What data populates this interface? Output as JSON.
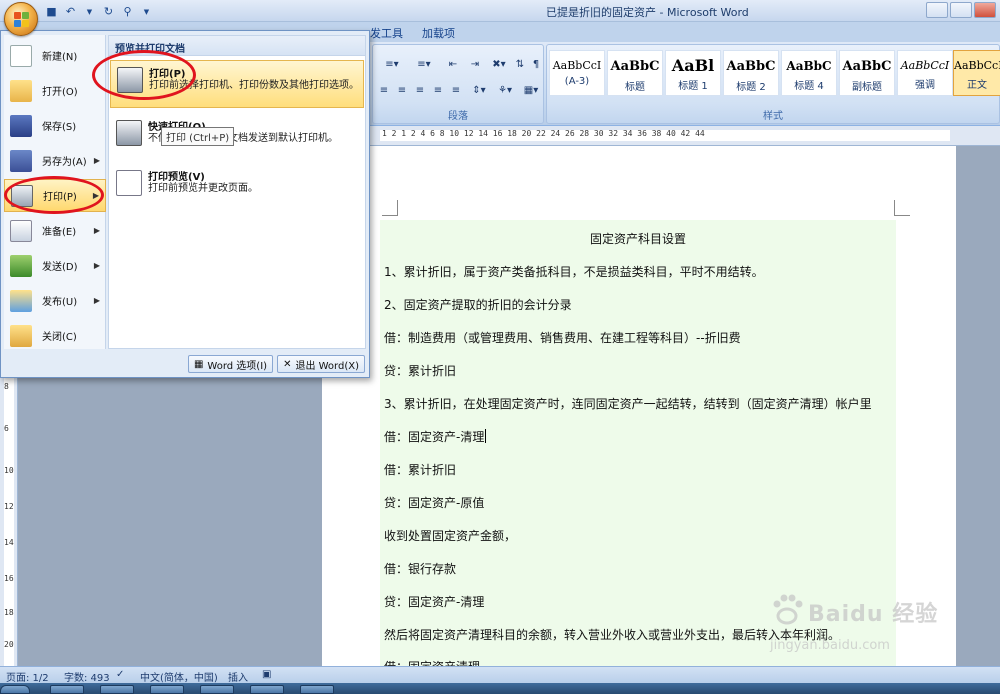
{
  "window": {
    "title": "已提是折旧的固定资产 - Microsoft Word"
  },
  "ribbon": {
    "tabs": [
      "发工具",
      "加载项"
    ],
    "paragraph_label": "段落",
    "styles_label": "样式",
    "styles": [
      {
        "sample": "AaBbCcI",
        "name": "(A-3)"
      },
      {
        "sample": "AaBbC",
        "name": "标题"
      },
      {
        "sample": "AaBl",
        "name": "标题 1"
      },
      {
        "sample": "AaBbC",
        "name": "标题 2"
      },
      {
        "sample": "AaBbC",
        "name": "标题 4"
      },
      {
        "sample": "AaBbC",
        "name": "副标题"
      },
      {
        "sample": "AaBbCcI",
        "name": "强调"
      },
      {
        "sample": "AaBbCcI",
        "name": "正文",
        "active": true
      }
    ]
  },
  "ruler": {
    "top_text": "1  2  1  2  4  6  8  10  12  14  16  18  20  22  24  26  28  30  32  34  36  38  40  42  44",
    "left_numbers": [
      "8",
      "6",
      "10",
      "12",
      "14",
      "16",
      "18",
      "20",
      "22"
    ]
  },
  "document": {
    "lines": [
      "固定资产科目设置",
      "1、累计折旧，属于资产类备抵科目，不是损益类科目，平时不用结转。",
      "2、固定资产提取的折旧的会计分录",
      "借：制造费用（或管理费用、销售费用、在建工程等科目）--折旧费",
      "贷：累计折旧",
      "3、累计折旧，在处理固定资产时，连同固定资产一起结转，结转到（固定资产清理）帐户里",
      "借：固定资产-清理",
      "借：累计折旧",
      "贷：固定资产-原值",
      "收到处置固定资产金额，",
      "借：银行存款",
      "贷：固定资产-清理",
      "然后将固定资产清理科目的余额，转入营业外收入或营业外支出，最后转入本年利润。",
      "借：固定资产清理"
    ]
  },
  "office_menu": {
    "items": [
      {
        "label": "新建(N)",
        "icon": "new-document-icon",
        "has_arrow": false
      },
      {
        "label": "打开(O)",
        "icon": "open-folder-icon",
        "has_arrow": false
      },
      {
        "label": "保存(S)",
        "icon": "save-icon",
        "has_arrow": false
      },
      {
        "label": "另存为(A)",
        "icon": "save-as-icon",
        "has_arrow": true
      },
      {
        "label": "打印(P)",
        "icon": "print-icon",
        "has_arrow": true,
        "selected": true
      },
      {
        "label": "准备(E)",
        "icon": "prepare-icon",
        "has_arrow": true
      },
      {
        "label": "发送(D)",
        "icon": "send-icon",
        "has_arrow": true
      },
      {
        "label": "发布(U)",
        "icon": "publish-icon",
        "has_arrow": true
      },
      {
        "label": "关闭(C)",
        "icon": "close-folder-icon",
        "has_arrow": false
      }
    ],
    "submenu_header": "预览并打印文档",
    "submenu": [
      {
        "title": "打印(P)",
        "desc": "打印前选择打印机、打印份数及其他打印选项。",
        "icon": "printer-icon",
        "highlighted": true
      },
      {
        "title": "快速打印(Q)",
        "desc": "不做更改，直接将文档发送到默认打印机。",
        "icon": "quick-print-icon"
      },
      {
        "title": "打印预览(V)",
        "desc": "打印前预览并更改页面。",
        "icon": "print-preview-icon"
      }
    ],
    "tooltip": "打印 (Ctrl+P)",
    "word_options_label": "Word 选项(I)",
    "exit_word_label": "退出 Word(X)"
  },
  "statusbar": {
    "page": "页面: 1/2",
    "words": "字数: 493",
    "language": "中文(简体，中国)",
    "insert_mode": "插入"
  },
  "watermark": {
    "brand": "Baidu 经验",
    "url": "jingyan.baidu.com"
  }
}
